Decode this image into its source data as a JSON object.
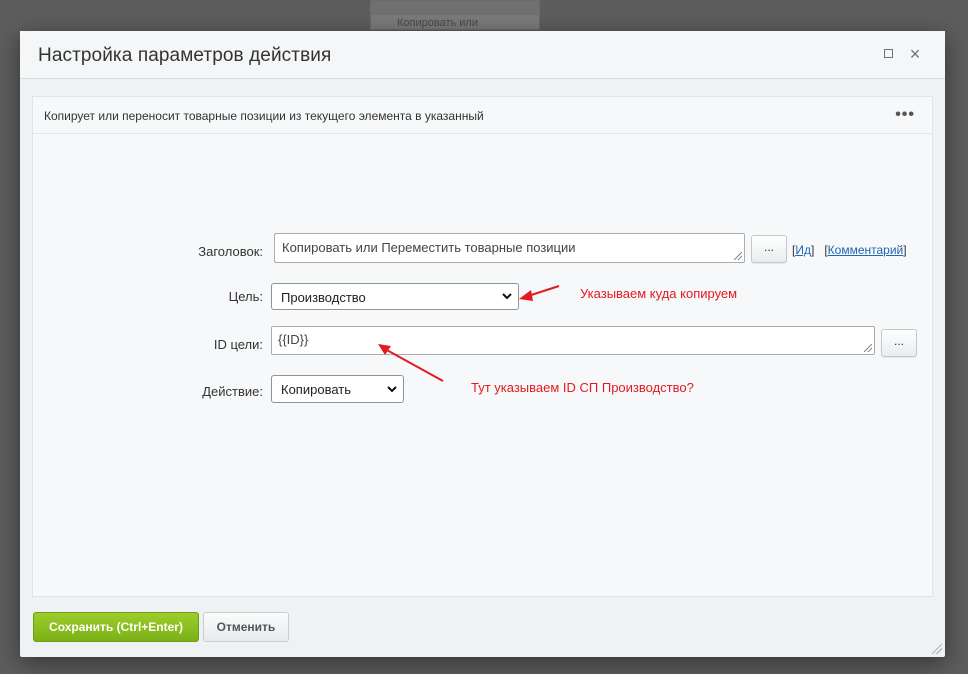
{
  "background": {
    "card_text": "Копировать или"
  },
  "dialog": {
    "title": "Настройка параметров действия",
    "maximize_label": "□",
    "close_label": "×"
  },
  "panel": {
    "description": "Копирует или переносит товарные позиции из текущего элемента в указанный",
    "more_label": "•••"
  },
  "form": {
    "title_label": "Заголовок:",
    "title_value": "Копировать или Переместить товарные позиции",
    "title_dots": "...",
    "link_id": "Ид",
    "link_comment": "Комментарий",
    "target_label": "Цель:",
    "target_value": "Производство",
    "target_id_label": "ID цели:",
    "target_id_value": "{{ID}}",
    "target_id_dots": "...",
    "action_label": "Действие:",
    "action_value": "Копировать"
  },
  "annotations": {
    "target_note": "Указываем куда копируем",
    "id_note": "Тут указываем ID СП Производство?",
    "color": "#e11b22"
  },
  "footer": {
    "save_label": "Сохранить (Ctrl+Enter)",
    "cancel_label": "Отменить"
  },
  "colors": {
    "save_button": "#8bc220",
    "link": "#2067b0"
  }
}
